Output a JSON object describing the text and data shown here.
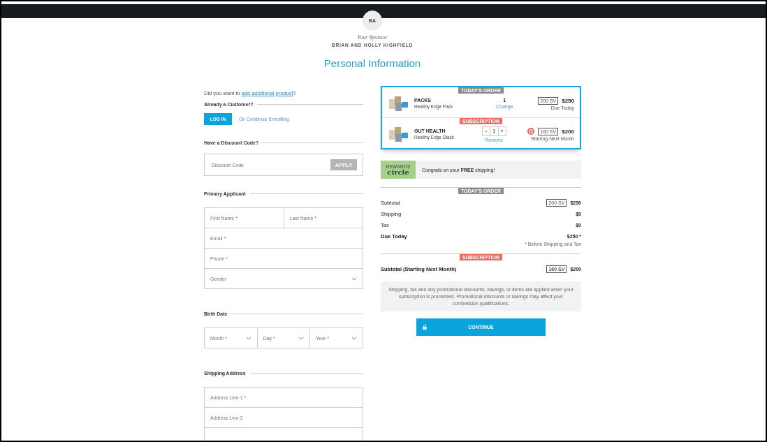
{
  "sponsor": {
    "initials": "BA",
    "label": "Your Sponsor",
    "name": "BRIAN AND HOLLY HIGHFIELD"
  },
  "title": "Personal Information",
  "prompt": {
    "before": "Did you want to ",
    "link": "add additional product",
    "after": "?"
  },
  "login": {
    "heading": "Already a Customer?",
    "button": "LOG IN",
    "link": "Or Continue Enrolling"
  },
  "discount": {
    "heading": "Have a Discount Code?",
    "placeholder": "Discount Code",
    "button": "APPLY",
    "disabled": true
  },
  "applicant": {
    "heading": "Primary Applicant",
    "rows": [
      [
        {
          "kind": "text",
          "placeholder": "First Name *"
        },
        {
          "kind": "text",
          "placeholder": "Last Name *"
        }
      ],
      [
        {
          "kind": "text",
          "placeholder": "Email *"
        }
      ],
      [
        {
          "kind": "text",
          "placeholder": "Phone *"
        }
      ],
      [
        {
          "kind": "select",
          "placeholder": "Gender"
        }
      ]
    ]
  },
  "birth_date": {
    "heading": "Birth Date",
    "rows": [
      [
        {
          "kind": "select",
          "placeholder": "Month *"
        },
        {
          "kind": "select",
          "placeholder": "Day *"
        },
        {
          "kind": "select",
          "placeholder": "Year *"
        }
      ]
    ]
  },
  "shipping": {
    "heading": "Shipping Address",
    "rows": [
      [
        {
          "kind": "text",
          "placeholder": "Address Line 1 *"
        }
      ],
      [
        {
          "kind": "text",
          "placeholder": "Address Line 2"
        }
      ],
      [
        {
          "kind": "text"
        }
      ]
    ]
  },
  "cart": [
    {
      "badge": "TODAY'S ORDER",
      "color": "#8a8a8a",
      "name": "PACKS",
      "product": "Healthy Edge Pack",
      "kind": "fixed",
      "quantity": "1",
      "action": "Change",
      "sv": "200 SV",
      "price": "$250",
      "note": "Due Today"
    },
    {
      "badge": "SUBSCRIPTION",
      "color": "#f06a64",
      "name": "GUT HEALTH",
      "product": "Healthy Edge Stack",
      "kind": "stepper",
      "quantity": "1",
      "minus": "-",
      "plus": "+",
      "action": "Remove",
      "sv": "160 SV",
      "price": "$200",
      "note": "Starting Next Month"
    }
  ],
  "rewards": {
    "logo_small": "REWARDS",
    "logo": "circle",
    "message": "Congrats on your **FREE** shipping!"
  },
  "summary": [
    {
      "badge": "TODAY'S ORDER",
      "color": "#8a8a8a",
      "lines": [
        {
          "label": "Subtotal",
          "sv": "200 SV",
          "value": "$250",
          "bold": false
        },
        {
          "label": "Shipping",
          "value": "$0",
          "bold": false
        },
        {
          "label": "Tax",
          "value": "$0",
          "bold": false
        },
        {
          "label": "Due Today",
          "value": "$250 *",
          "bold": true
        }
      ],
      "footnote": "* Before Shipping and Tax"
    },
    {
      "badge": "SUBSCRIPTION",
      "color": "#f06a64",
      "lines": [
        {
          "label": "Subtotal (Starting Next Month)",
          "sv": "160 SV",
          "value": "$200",
          "bold": true
        }
      ]
    }
  ],
  "notice": "Shipping, tax and any promotional discounts, savings, or items are applied when your subscription is processed. Promotional discounts or savings may affect your commission qualifications.",
  "continue_button": "CONTINUE"
}
